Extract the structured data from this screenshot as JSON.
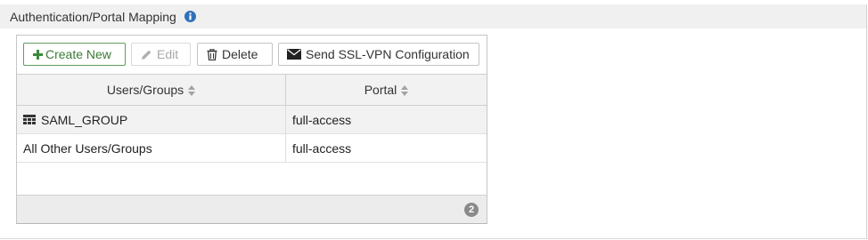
{
  "section": {
    "title": "Authentication/Portal Mapping",
    "info_icon": "info-circle-icon"
  },
  "toolbar": {
    "create_label": "Create New",
    "edit_label": "Edit",
    "delete_label": "Delete",
    "send_label": "Send SSL-VPN Configuration"
  },
  "table": {
    "columns": [
      "Users/Groups",
      "Portal"
    ],
    "rows": [
      {
        "users_groups": "SAML_GROUP",
        "portal": "full-access",
        "icon": "user-group-icon"
      },
      {
        "users_groups": "All Other Users/Groups",
        "portal": "full-access"
      }
    ],
    "count": "2"
  },
  "colors": {
    "create_accent": "#3a7a3a",
    "info_blue": "#2f72b8",
    "header_bg": "#f0f0f0"
  }
}
